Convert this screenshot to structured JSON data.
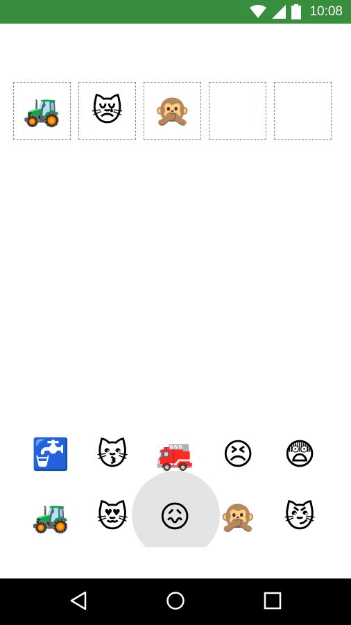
{
  "status_bar": {
    "time": "10:08",
    "icons": [
      "wifi-icon",
      "cell-signal-icon",
      "battery-icon"
    ],
    "background": "#388e3c"
  },
  "answer_slots": [
    {
      "emoji": "🚜",
      "name": "tractor"
    },
    {
      "emoji": "😿",
      "name": "crying-cat"
    },
    {
      "emoji": "🙊",
      "name": "speak-no-evil-monkey"
    },
    {
      "emoji": "",
      "name": "empty"
    },
    {
      "emoji": "",
      "name": "empty"
    }
  ],
  "emoji_choices": {
    "row1": [
      {
        "emoji": "🚰",
        "name": "potable-water"
      },
      {
        "emoji": "😽",
        "name": "kissing-cat"
      },
      {
        "emoji": "🚒",
        "name": "fire-engine"
      },
      {
        "emoji": "😣",
        "name": "persevering-face"
      },
      {
        "emoji": "😨",
        "name": "fearful-face"
      }
    ],
    "row2": [
      {
        "emoji": "🚜",
        "name": "tractor"
      },
      {
        "emoji": "😻",
        "name": "heart-eyes-cat"
      },
      {
        "emoji": "😖",
        "name": "confounded-face"
      },
      {
        "emoji": "🙊",
        "name": "speak-no-evil-monkey"
      },
      {
        "emoji": "😼",
        "name": "smirking-cat"
      }
    ],
    "selected_index_row2": 2
  },
  "nav_bar": {
    "icons": [
      "back-icon",
      "home-icon",
      "recents-icon"
    ]
  }
}
